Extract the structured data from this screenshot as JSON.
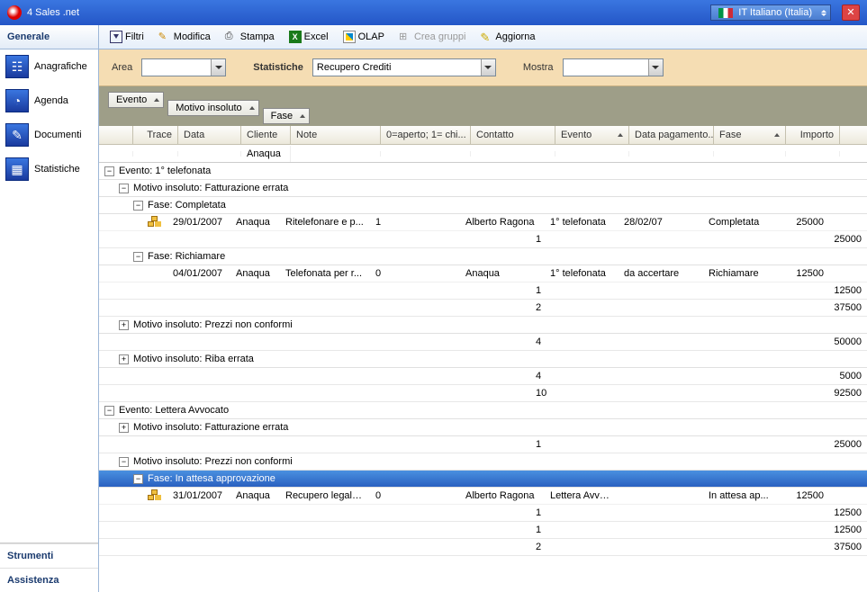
{
  "app": {
    "title": "4 Sales .net"
  },
  "language": {
    "label": "IT Italiano (Italia)"
  },
  "sidebar": {
    "header": "Generale",
    "items": [
      {
        "label": "Anagrafiche"
      },
      {
        "label": "Agenda"
      },
      {
        "label": "Documenti"
      },
      {
        "label": "Statistiche"
      }
    ],
    "footer": [
      {
        "label": "Strumenti"
      },
      {
        "label": "Assistenza"
      }
    ]
  },
  "toolbar": {
    "filtri": "Filtri",
    "modifica": "Modifica",
    "stampa": "Stampa",
    "excel": "Excel",
    "olap": "OLAP",
    "crea_gruppi": "Crea gruppi",
    "aggiorna": "Aggiorna"
  },
  "filters": {
    "area_label": "Area",
    "area_value": "",
    "stat_label": "Statistiche",
    "stat_value": "Recupero Crediti",
    "mostra_label": "Mostra",
    "mostra_value": ""
  },
  "group_chips": {
    "g1": "Evento",
    "g2": "Motivo insoluto",
    "g3": "Fase"
  },
  "columns": {
    "trace": "Trace",
    "data": "Data",
    "cliente": "Cliente",
    "note": "Note",
    "aperto": "0=aperto; 1= chi...",
    "contatto": "Contatto",
    "evento": "Evento",
    "pagamento": "Data pagamento...",
    "fase": "Fase",
    "importo": "Importo"
  },
  "filter_row": {
    "cliente": "Anaqua"
  },
  "grid": {
    "ev1": {
      "label": "Evento: 1° telefonata",
      "m1": {
        "label": "Motivo insoluto: Fatturazione errata",
        "f1": {
          "label": "Fase: Completata",
          "row": {
            "data": "29/01/2007",
            "cliente": "Anaqua",
            "note": "Ritelefonare e p...",
            "aperto": "1",
            "contatto": "Alberto Ragona",
            "evento": "1° telefonata",
            "pag": "28/02/07",
            "fase": "Completata",
            "importo": "25000"
          },
          "sum": {
            "count": "1",
            "importo": "25000"
          }
        },
        "f2": {
          "label": "Fase: Richiamare",
          "row": {
            "data": "04/01/2007",
            "cliente": "Anaqua",
            "note": "Telefonata per r...",
            "aperto": "0",
            "contatto": "Anaqua",
            "evento": "1° telefonata",
            "pag": "da accertare",
            "fase": "Richiamare",
            "importo": "12500"
          },
          "sum": {
            "count": "1",
            "importo": "12500"
          }
        },
        "total": {
          "count": "2",
          "importo": "37500"
        }
      },
      "m2": {
        "label": "Motivo insoluto: Prezzi non conformi",
        "total": {
          "count": "4",
          "importo": "50000"
        }
      },
      "m3": {
        "label": "Motivo insoluto: Riba errata",
        "total": {
          "count": "4",
          "importo": "5000"
        }
      },
      "total": {
        "count": "10",
        "importo": "92500"
      }
    },
    "ev2": {
      "label": "Evento: Lettera Avvocato",
      "m1": {
        "label": "Motivo insoluto: Fatturazione errata",
        "total": {
          "count": "1",
          "importo": "25000"
        }
      },
      "m2": {
        "label": "Motivo insoluto: Prezzi non conformi",
        "f1": {
          "label": "Fase: In attesa approvazione",
          "row": {
            "data": "31/01/2007",
            "cliente": "Anaqua",
            "note": "Recupero legale...",
            "aperto": "0",
            "contatto": "Alberto Ragona",
            "evento": "Lettera Avvo...",
            "pag": "",
            "fase": "In attesa ap...",
            "importo": "12500"
          },
          "sum": {
            "count": "1",
            "importo": "12500"
          }
        },
        "total": {
          "count": "1",
          "importo": "12500"
        }
      },
      "total": {
        "count": "2",
        "importo": "37500"
      }
    }
  }
}
